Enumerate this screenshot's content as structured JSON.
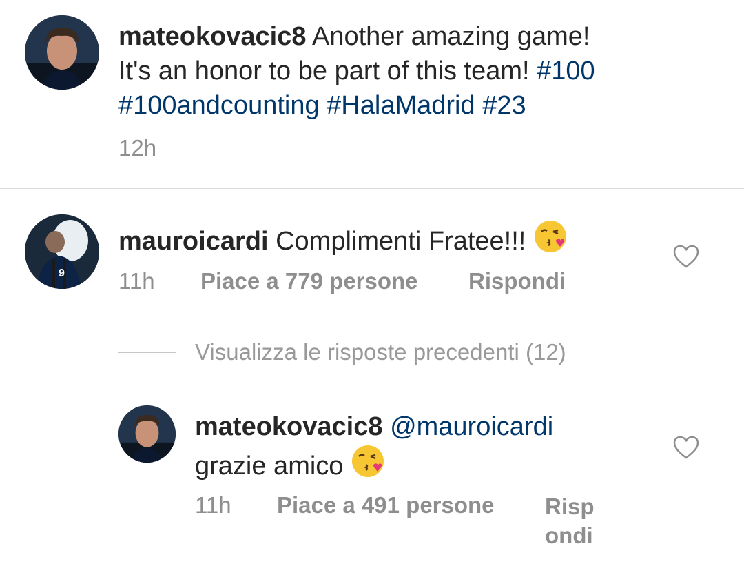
{
  "caption": {
    "username": "mateokovacic8",
    "text_line1": "Another amazing game!",
    "text_line2": "It's an honor to be part of this team!",
    "hashtags": [
      "#100",
      "#100andcounting",
      "#HalaMadrid",
      "#23"
    ],
    "time": "12h"
  },
  "comment": {
    "username": "mauroicardi",
    "text": "Complimenti Fratee!!!",
    "emoji": "kissing-face-emoji",
    "time": "11h",
    "likes_label": "Piace a 779 persone",
    "reply_label": "Rispondi"
  },
  "view_replies": {
    "label": "Visualizza le risposte precedenti (12)"
  },
  "reply": {
    "username": "mateokovacic8",
    "mention": "@mauroicardi",
    "text": "grazie amico",
    "emoji": "kissing-face-emoji",
    "time": "11h",
    "likes_label": "Piace a 491 persone",
    "reply_label_part1": "Risp",
    "reply_label_part2": "ondi"
  },
  "colors": {
    "text": "#262626",
    "hashtag": "#00376b",
    "meta": "#8e8e8e",
    "divider": "#dbdbdb"
  }
}
